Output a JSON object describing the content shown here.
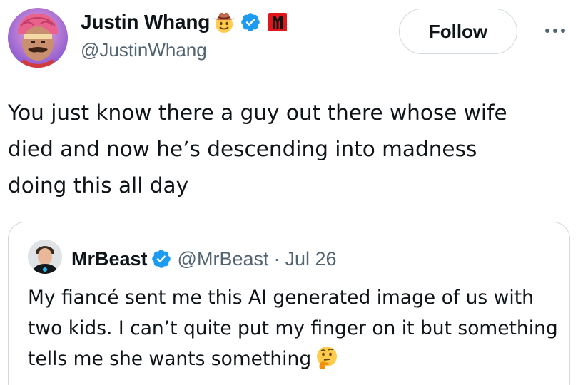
{
  "author": {
    "display_name": "Justin Whang",
    "handle": "@JustinWhang",
    "name_emoji_icon": "cowboy-hat-face-emoji",
    "verified_icon": "verified-badge-icon",
    "affiliate_icon": "affiliate-badge-icon"
  },
  "actions": {
    "follow_label": "Follow",
    "more_icon": "more-options-icon"
  },
  "tweet": {
    "text": "You just know there a guy out there whose wife\ndied and now he’s descending into madness\ndoing this all day"
  },
  "quoted_tweet": {
    "display_name": "MrBeast",
    "handle": "@MrBeast",
    "separator": "·",
    "date": "Jul 26",
    "text": "My fiancé sent me this AI generated image of us with two kids. I can’t quite put my finger on it but something tells me she wants something",
    "trailing_emoji_icon": "thinking-face-emoji"
  },
  "colors": {
    "text_primary": "#0f1419",
    "text_secondary": "#536471",
    "border": "#cfd9de",
    "verified_blue": "#1d9bf0",
    "affiliate_red": "#e0161e"
  }
}
